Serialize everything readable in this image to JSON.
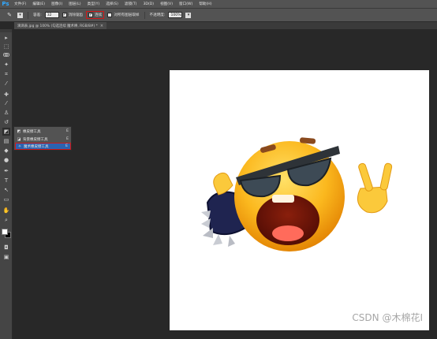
{
  "app": {
    "logo": "Ps"
  },
  "menubar": {
    "items": [
      "文件(F)",
      "编辑(E)",
      "图像(I)",
      "图层(L)",
      "类型(Y)",
      "选择(S)",
      "滤镜(T)",
      "3D(D)",
      "视图(V)",
      "窗口(W)",
      "帮助(H)"
    ]
  },
  "options": {
    "tolerance_label": "容差:",
    "tolerance_value": "32",
    "antialias_label": "消除锯齿",
    "contiguous_label": "连续",
    "all_layers_label": "对所有图层取样",
    "opacity_label": "不透明度:",
    "opacity_value": "100%"
  },
  "document_tab": {
    "title": "滴滴表.jpg @ 100% (勾选连续 魔术棒, RGB/8#) *",
    "close": "×"
  },
  "tool_flyout": {
    "items": [
      {
        "label": "橡皮擦工具",
        "shortcut": "E",
        "selected": false
      },
      {
        "label": "背景橡皮擦工具",
        "shortcut": "E",
        "selected": false
      },
      {
        "label": "魔术橡皮擦工具",
        "shortcut": "E",
        "selected": true
      }
    ]
  },
  "colors": {
    "foreground": "#ffffff",
    "background": "#000000",
    "highlight": "#d01818",
    "selection": "#2b63b0"
  },
  "watermark": "CSDN @木棉花I"
}
